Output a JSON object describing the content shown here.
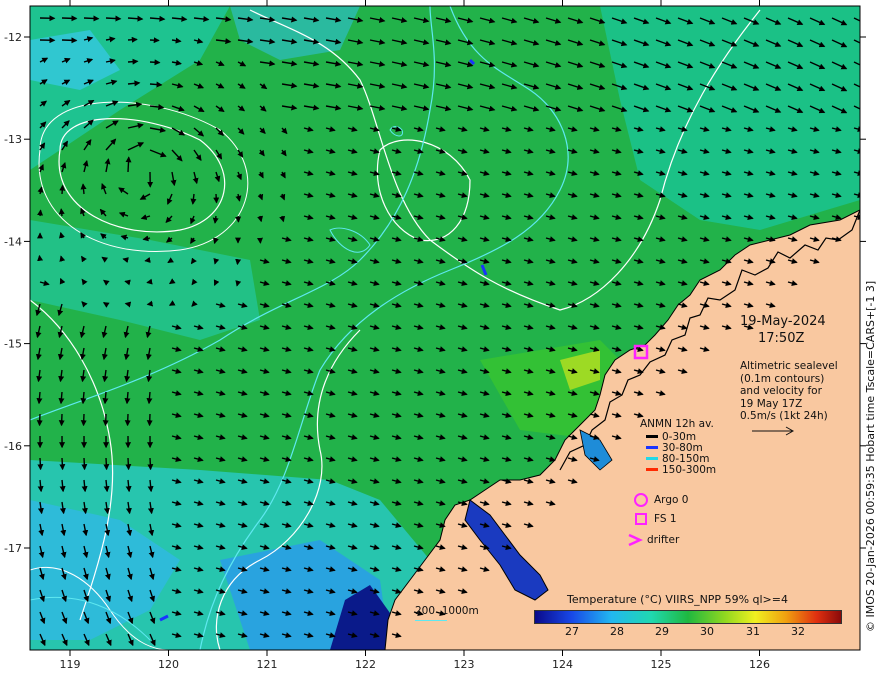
{
  "map": {
    "date": "19-May-2024",
    "time": "17:50Z",
    "sealevel_note": [
      "Altimetric sealevel",
      "(0.1m contours)",
      "and velocity for",
      "19 May 17Z",
      "0.5m/s (1kt 24h)"
    ],
    "credit": "© IMOS 20-Jan-2026 00:59:35 Hobart time Tscale=CARS+[-1 3]",
    "x_ticks": [
      "119",
      "120",
      "121",
      "122",
      "123",
      "124",
      "125",
      "126"
    ],
    "y_ticks": [
      "-12",
      "-13",
      "-14",
      "-15",
      "-16",
      "-17"
    ],
    "depth_scale_label": "200  1000m",
    "colorbar": {
      "title": "Temperature (°C) VIIRS_NPP 59% ql>=4",
      "ticks": [
        "27",
        "28",
        "29",
        "30",
        "31",
        "32"
      ]
    },
    "legend": {
      "title": "ANMN 12h av.",
      "items": [
        {
          "label": "0-30m",
          "color": "#000000"
        },
        {
          "label": "30-80m",
          "color": "#1a33ff"
        },
        {
          "label": "80-150m",
          "color": "#22d8e6"
        },
        {
          "label": "150-300m",
          "color": "#ff2a00"
        }
      ],
      "markers": [
        {
          "label": "Argo 0",
          "symbol": "circle"
        },
        {
          "label": "FS 1",
          "symbol": "square"
        },
        {
          "label": "drifter",
          "symbol": "chevron"
        }
      ]
    },
    "colors": {
      "land": "#f9c8a0",
      "sea": "#22b24a",
      "sea_alt": "#10c8a0",
      "sea_cool": "#28d8d0",
      "sea_deep": "#1e7ad8",
      "marker": "#ff22ff",
      "contour_white": "#ffffff",
      "contour_cyan": "#5fe8f0"
    }
  }
}
